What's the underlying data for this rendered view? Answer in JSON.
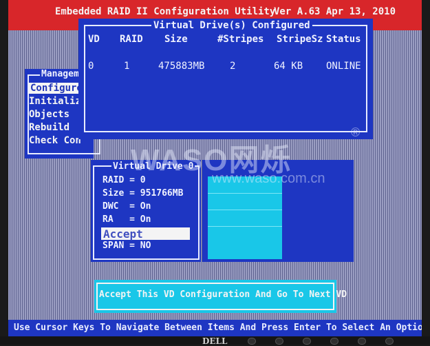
{
  "header": {
    "app_title": "Embedded RAID II Configuration Utility",
    "version": "Ver A.63 Apr 13, 2010"
  },
  "management_menu": {
    "title": "Managem",
    "items": [
      "Configure",
      "Initializ",
      "Objects",
      "Rebuild",
      "Check Con"
    ],
    "selected_index": 0
  },
  "virtual_drives_configured": {
    "title": "Virtual Drive(s) Configured",
    "columns": [
      "VD",
      "RAID",
      "Size",
      "#Stripes",
      "StripeSz",
      "Status"
    ],
    "rows": [
      {
        "vd": "0",
        "raid": "1",
        "size": "475883MB",
        "stripes": "2",
        "stripe_sz": "64 KB",
        "status": "ONLINE"
      }
    ]
  },
  "virtual_drive_0": {
    "title": "Virtual Drive 0",
    "raid": "RAID = 0",
    "size": "Size = 951766MB",
    "dwc": "DWC  = On",
    "ra": "RA   = On",
    "accept": "Accept",
    "span": "SPAN = NO"
  },
  "accept_bar": {
    "label": "Accept This VD Configuration And Go To Next VD"
  },
  "status_bar": {
    "text": "Use Cursor Keys To Navigate Between Items And Press Enter To Select An Option"
  },
  "watermark": {
    "brand": "WASO网烁",
    "url": "www.waso.com.cn",
    "reg": "®"
  },
  "monitor": {
    "logo": "DELL"
  },
  "colors": {
    "title_bar": "#d8262a",
    "panel_blue": "#1e36c2",
    "cyan": "#19c7e8",
    "background_lavender": "#8c8fb4"
  }
}
